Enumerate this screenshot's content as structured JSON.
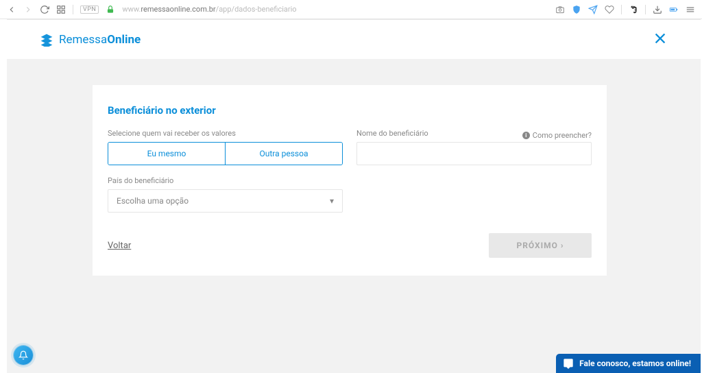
{
  "browser": {
    "url_host": "remessaonline.com.br",
    "url_prefix": "www.",
    "url_path": "/app/dados-beneficiario",
    "vpn_label": "VPN"
  },
  "logo": {
    "part1": "Remessa",
    "part2": "Online"
  },
  "form": {
    "title": "Beneficiário no exterior",
    "select_who_label": "Selecione quem vai receber os valores",
    "option_self": "Eu mesmo",
    "option_other": "Outra pessoa",
    "name_label": "Nome do beneficiário",
    "help_text": "Como preencher?",
    "country_label": "País do beneficiário",
    "country_placeholder": "Escolha uma opção",
    "back": "Voltar",
    "next": "PRÓXIMO ›"
  },
  "chat": {
    "label": "Fale conosco, estamos online!"
  }
}
